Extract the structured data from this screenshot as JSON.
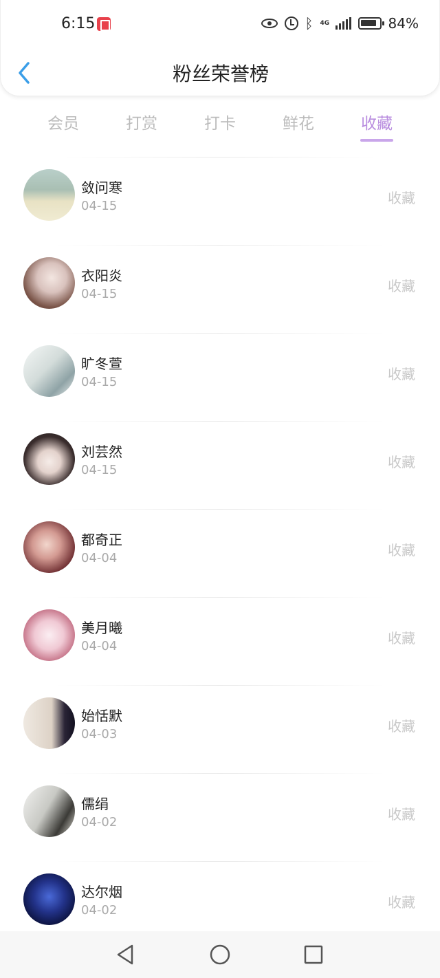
{
  "status_bar": {
    "time": "6:15",
    "network": "4G",
    "battery": "84%"
  },
  "header": {
    "title": "粉丝荣誉榜"
  },
  "tabs": [
    {
      "label": "会员",
      "active": false
    },
    {
      "label": "打赏",
      "active": false
    },
    {
      "label": "打卡",
      "active": false
    },
    {
      "label": "鲜花",
      "active": false
    },
    {
      "label": "收藏",
      "active": true
    }
  ],
  "colors": {
    "accent": "#b98ddf",
    "muted": "#c8c8c8",
    "back": "#3a9ee8"
  },
  "fans": [
    {
      "name": "敛问寒",
      "date": "04-15",
      "action": "收藏"
    },
    {
      "name": "衣阳炎",
      "date": "04-15",
      "action": "收藏"
    },
    {
      "name": "旷冬萱",
      "date": "04-15",
      "action": "收藏"
    },
    {
      "name": "刘芸然",
      "date": "04-15",
      "action": "收藏"
    },
    {
      "name": "都奇正",
      "date": "04-04",
      "action": "收藏"
    },
    {
      "name": "美月曦",
      "date": "04-04",
      "action": "收藏"
    },
    {
      "name": "始恬默",
      "date": "04-03",
      "action": "收藏"
    },
    {
      "name": "儒绢",
      "date": "04-02",
      "action": "收藏"
    },
    {
      "name": "达尔烟",
      "date": "04-02",
      "action": "收藏"
    }
  ]
}
